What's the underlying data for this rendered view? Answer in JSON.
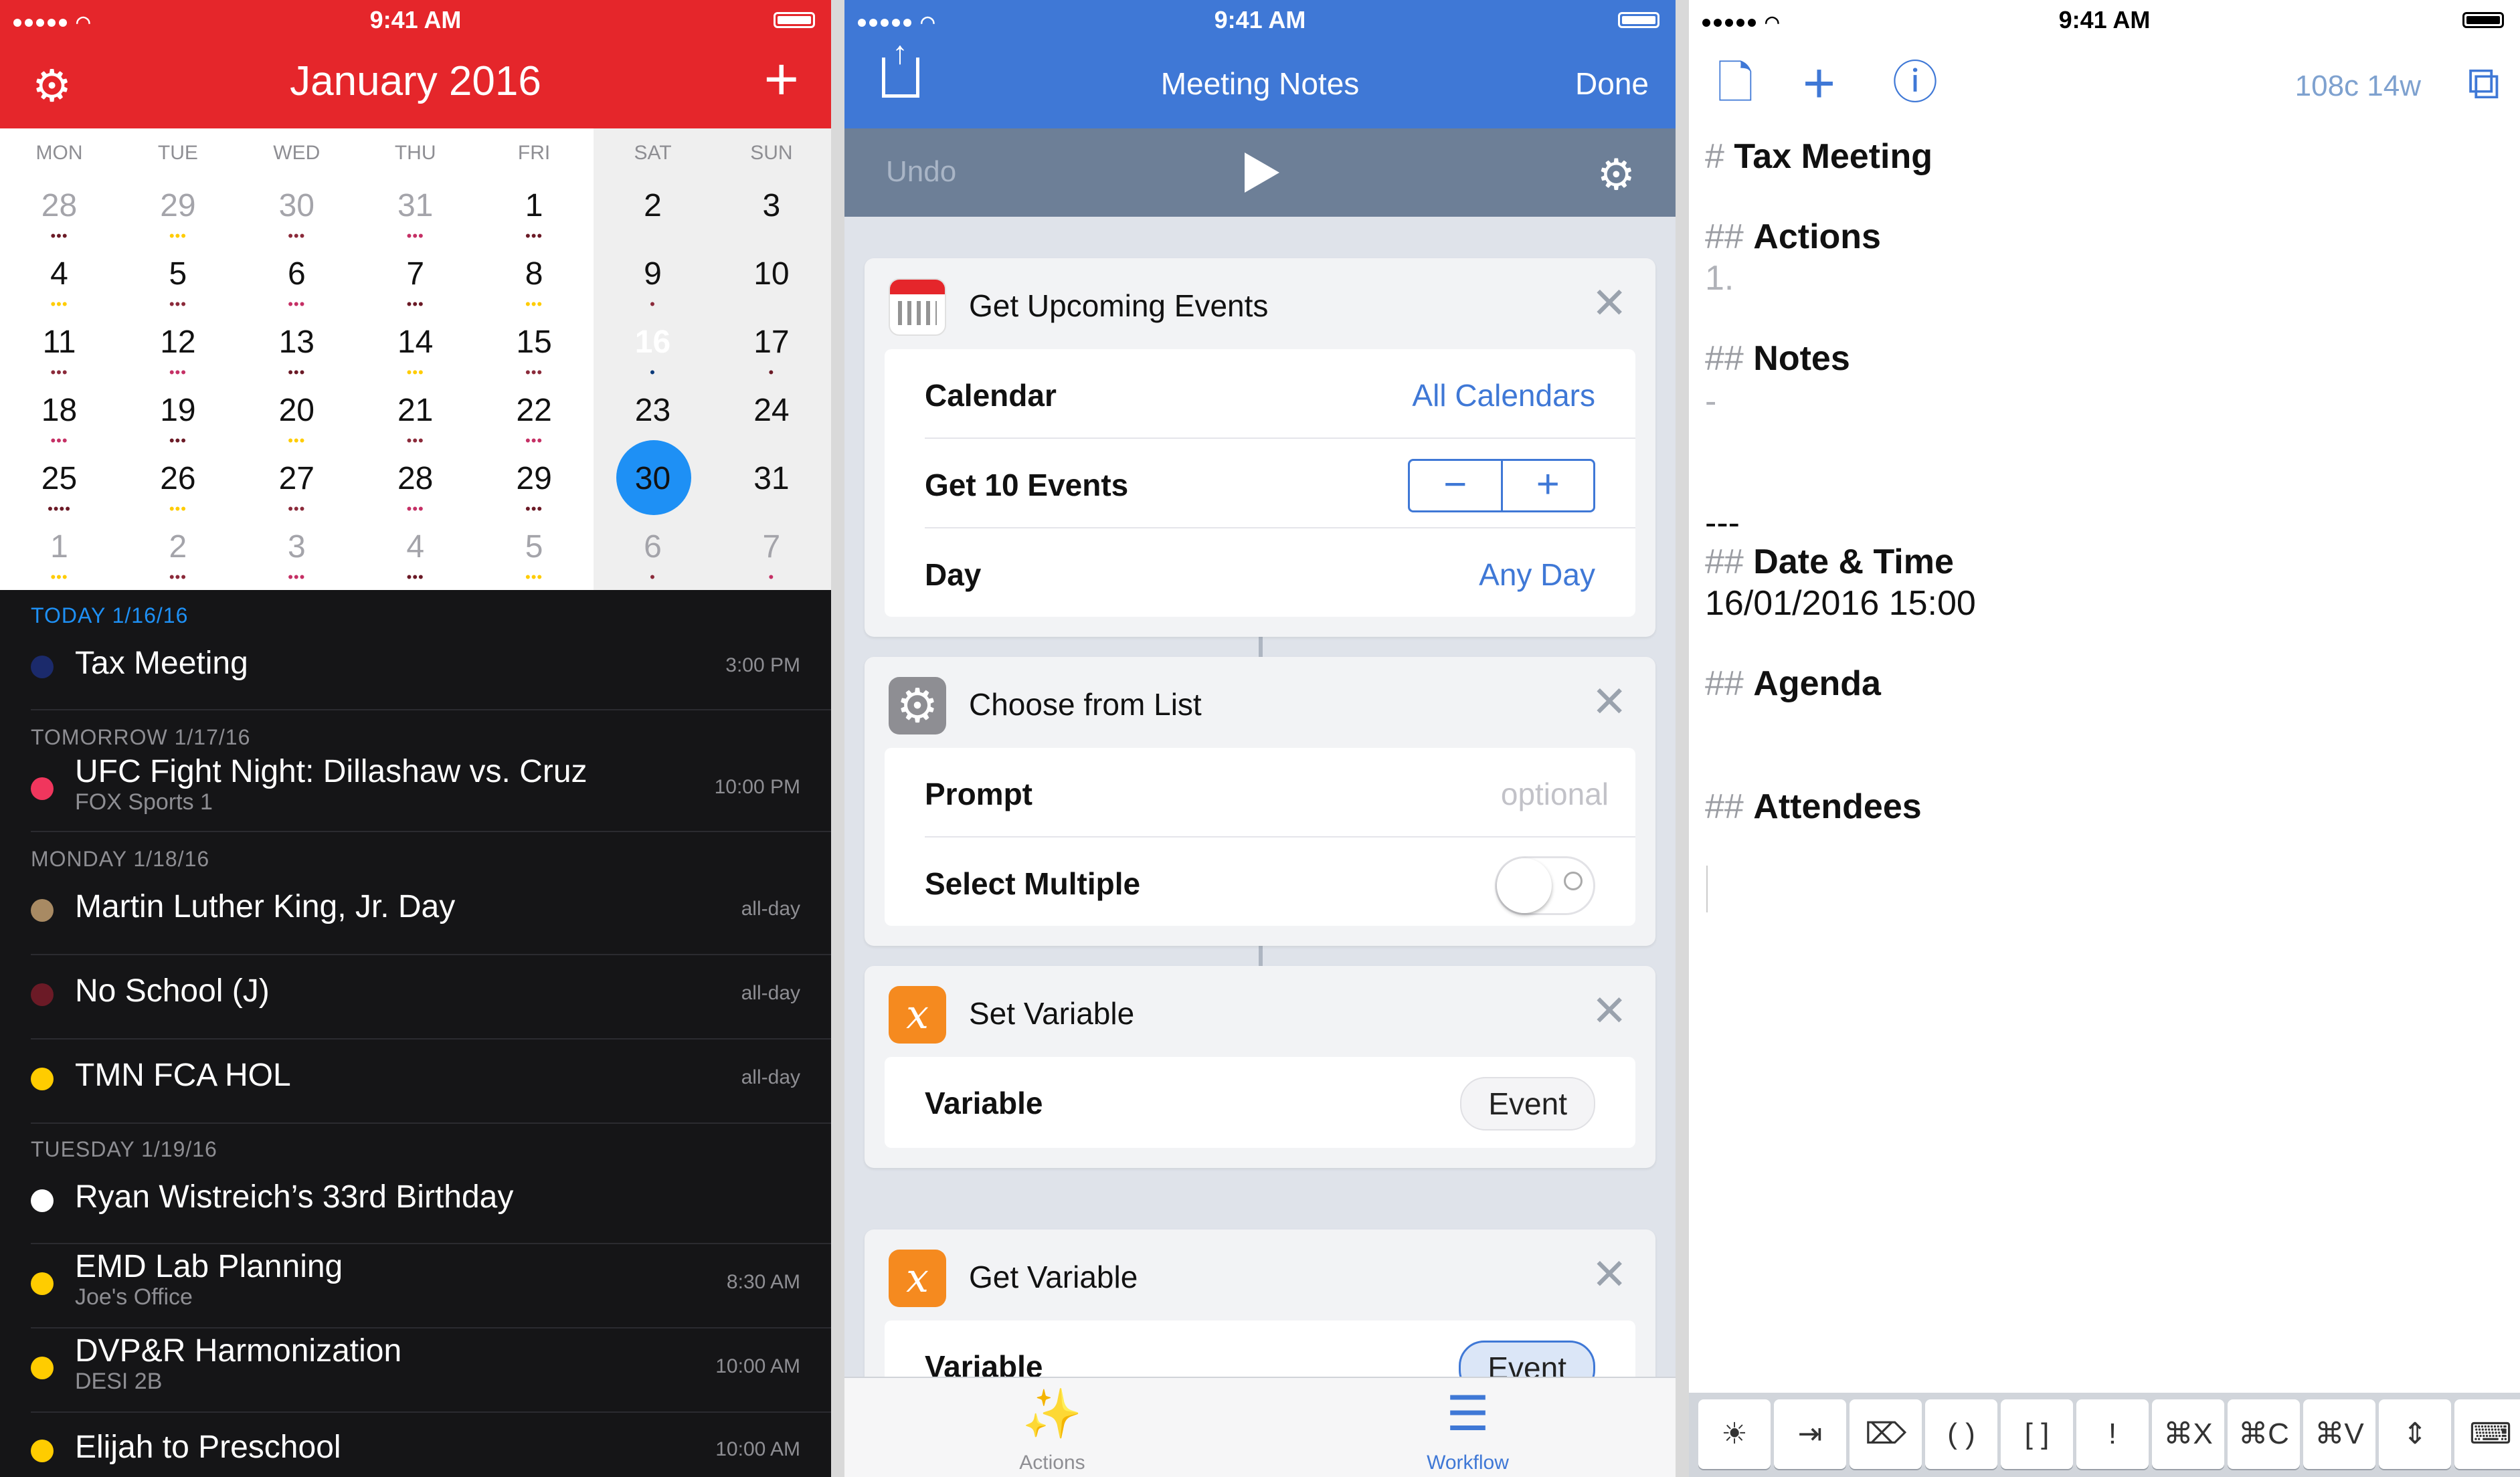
{
  "status": {
    "time": "9:41 AM"
  },
  "calendar": {
    "title": "January 2016",
    "weekdays": [
      "MON",
      "TUE",
      "WED",
      "THU",
      "FRI",
      "SAT",
      "SUN"
    ],
    "weeks": [
      [
        "28",
        "29",
        "30",
        "31",
        "1",
        "2",
        "3"
      ],
      [
        "4",
        "5",
        "6",
        "7",
        "8",
        "9",
        "10"
      ],
      [
        "11",
        "12",
        "13",
        "14",
        "15",
        "16",
        "17"
      ],
      [
        "18",
        "19",
        "20",
        "21",
        "22",
        "23",
        "24"
      ],
      [
        "25",
        "26",
        "27",
        "28",
        "29",
        "30",
        "31"
      ],
      [
        "1",
        "2",
        "3",
        "4",
        "5",
        "6",
        "7"
      ]
    ],
    "dots": [
      [
        "•••",
        "•••",
        "•••",
        "•••",
        "•••",
        "",
        ""
      ],
      [
        "•••",
        "•••",
        "•••",
        "•••",
        "•••",
        "•",
        ""
      ],
      [
        "•••",
        "•••",
        "•••",
        "•••",
        "•••",
        "•",
        "•"
      ],
      [
        "•••",
        "•••",
        "•••",
        "•••",
        "•••",
        "",
        ""
      ],
      [
        "••••",
        "•••",
        "•••",
        "•••",
        "•••",
        "",
        ""
      ],
      [
        "•••",
        "•••",
        "•••",
        "•••",
        "•••",
        "•",
        "•"
      ]
    ],
    "agenda": {
      "sections": [
        {
          "header": "TODAY  1/16/16"
        },
        {
          "header": "TOMORROW  1/17/16"
        },
        {
          "header": "MONDAY  1/18/16"
        },
        {
          "header": "TUESDAY  1/19/16"
        }
      ],
      "events": [
        {
          "title": "Tax Meeting",
          "sub": "",
          "time": "3:00 PM",
          "color": "#1b2a6b"
        },
        {
          "title": "UFC Fight Night: Dillashaw vs. Cruz",
          "sub": "FOX Sports 1",
          "time": "10:00 PM",
          "color": "#f0365d"
        },
        {
          "title": "Martin Luther King, Jr. Day",
          "sub": "",
          "time": "all-day",
          "color": "#a88a63"
        },
        {
          "title": "No School (J)",
          "sub": "",
          "time": "all-day",
          "color": "#6b1a26"
        },
        {
          "title": "TMN FCA HOL",
          "sub": "",
          "time": "all-day",
          "color": "#ffcc00"
        },
        {
          "title": "Ryan Wistreich’s 33rd Birthday",
          "sub": "",
          "time": "",
          "color": "#ffffff"
        },
        {
          "title": "EMD Lab Planning",
          "sub": "Joe's Office",
          "time": "8:30 AM",
          "color": "#ffcc00"
        },
        {
          "title": "DVP&R Harmonization",
          "sub": "DESI 2B",
          "time": "10:00 AM",
          "color": "#ffcc00"
        },
        {
          "title": "Elijah to Preschool",
          "sub": "",
          "time": "10:00 AM",
          "color": "#ffcc00"
        }
      ]
    }
  },
  "workflow": {
    "title": "Meeting Notes",
    "done": "Done",
    "undo": "Undo",
    "cards": {
      "upcoming": {
        "title": "Get Upcoming Events",
        "calendar_label": "Calendar",
        "calendar_value": "All Calendars",
        "count_label": "Get 10 Events",
        "day_label": "Day",
        "day_value": "Any Day"
      },
      "choose": {
        "title": "Choose from List",
        "prompt_label": "Prompt",
        "prompt_placeholder": "optional",
        "multiple_label": "Select Multiple",
        "multiple_on": false
      },
      "setvar": {
        "title": "Set Variable",
        "var_label": "Variable",
        "var_value": "Event"
      },
      "getvar": {
        "title": "Get Variable",
        "var_label": "Variable",
        "var_value": "Event"
      }
    },
    "tabs": {
      "actions": "Actions",
      "workflow": "Workflow"
    },
    "accent": "#3f78d6"
  },
  "editor": {
    "count": "108c 14w",
    "lines": [
      {
        "hash": "#",
        "text": "Tax Meeting"
      },
      {
        "hash": "##",
        "text": "Actions"
      },
      {
        "text": "1."
      },
      {
        "hash": "##",
        "text": "Notes"
      },
      {
        "text": "-"
      },
      {
        "text": "---"
      },
      {
        "hash": "##",
        "text": "Date & Time"
      },
      {
        "text": "16/01/2016 15:00"
      },
      {
        "hash": "##",
        "text": "Agenda"
      },
      {
        "hash": "##",
        "text": "Attendees"
      }
    ],
    "keys": [
      "☀",
      "⇥",
      "⌦",
      "( )",
      "[ ]",
      "!",
      "⌘X",
      "⌘C",
      "⌘V",
      "⇕",
      "⌨"
    ]
  }
}
